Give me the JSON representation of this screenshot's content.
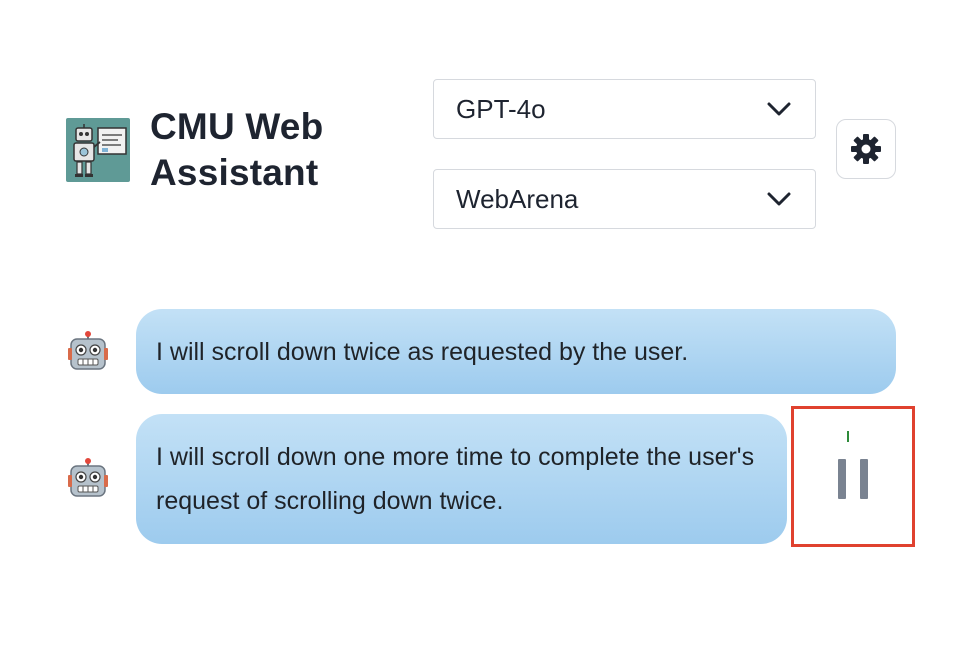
{
  "header": {
    "title": "CMU Web\nAssistant",
    "logo_icon": "robot-presenter-logo"
  },
  "selectors": {
    "model": {
      "value": "GPT-4o",
      "icon": "chevron-down-icon"
    },
    "environment": {
      "value": "WebArena",
      "icon": "chevron-down-icon"
    }
  },
  "settings": {
    "icon": "gear-icon"
  },
  "messages": [
    {
      "avatar": "robot-icon",
      "text": "I will scroll down twice as requested by the user."
    },
    {
      "avatar": "robot-icon",
      "text": "I will scroll down one more time to complete the user's request of scrolling down twice."
    }
  ],
  "controls": {
    "pause_icon": "pause-icon",
    "highlight_color": "#e0412f"
  },
  "colors": {
    "bubble_top": "#c3e1f6",
    "bubble_bottom": "#9dcbee",
    "logo_bg": "#5f9a96"
  }
}
